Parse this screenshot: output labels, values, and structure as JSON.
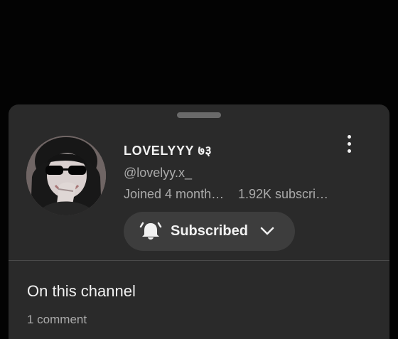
{
  "channel": {
    "name": "LOVELYYY ७३",
    "handle": "@lovelyy.x_",
    "joined": "Joined 4 month…",
    "subscribers": "1.92K subscri…"
  },
  "subscribe_button": {
    "label": "Subscribed",
    "icon": "bell-icon",
    "dropdown_icon": "chevron-down-icon"
  },
  "menu": {
    "icon": "more-vertical-icon"
  },
  "section": {
    "title": "On this channel",
    "comment_count": "1 comment"
  },
  "colors": {
    "background": "#030303",
    "sheet": "#2a2a2a",
    "button": "#3d3d3d",
    "primary_text": "#f1f1f1",
    "secondary_text": "#aaaaaa"
  }
}
